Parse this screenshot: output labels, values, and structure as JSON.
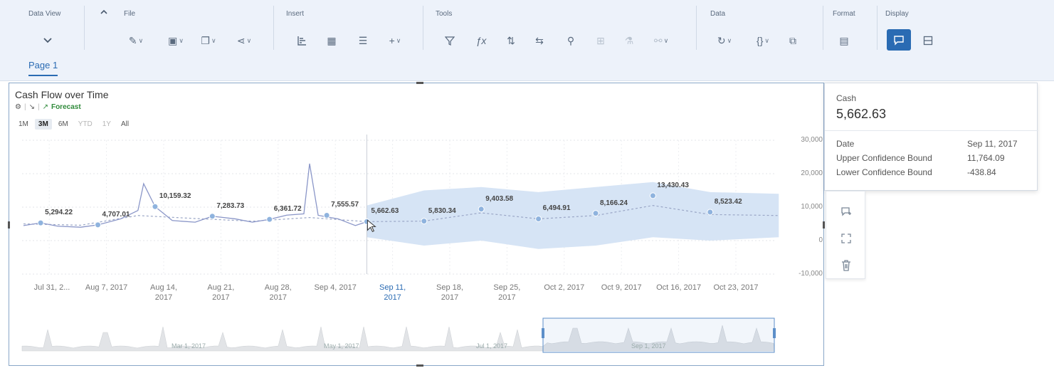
{
  "toolbar": {
    "data_view": {
      "title": "Data View",
      "chevron": "chevron-down-icon"
    },
    "file": {
      "title": "File",
      "collapse": "chevron-up-icon"
    },
    "insert": {
      "title": "Insert"
    },
    "tools": {
      "title": "Tools"
    },
    "data": {
      "title": "Data"
    },
    "format": {
      "title": "Format"
    },
    "display": {
      "title": "Display"
    },
    "accent": "#2a6bb3"
  },
  "tabs": [
    {
      "label": "Page 1"
    }
  ],
  "widget": {
    "title": "Cash Flow over Time",
    "forecast_label": "Forecast",
    "ranges": [
      "1M",
      "3M",
      "6M",
      "YTD",
      "1Y",
      "All"
    ],
    "selected_range": "3M"
  },
  "chart_data": {
    "type": "line",
    "y_ticks": [
      "30,000",
      "20,000",
      "10,000",
      "0",
      "-10,000"
    ],
    "ylim": [
      -10000,
      30000
    ],
    "x_ticks": [
      {
        "l1": "Jul 31, 2...",
        "l2": ""
      },
      {
        "l1": "Aug 7, 2017",
        "l2": ""
      },
      {
        "l1": "Aug 14,",
        "l2": "2017"
      },
      {
        "l1": "Aug 21,",
        "l2": "2017"
      },
      {
        "l1": "Aug 28,",
        "l2": "2017"
      },
      {
        "l1": "Sep 4, 2017",
        "l2": ""
      },
      {
        "l1": "Sep 11,",
        "l2": "2017"
      },
      {
        "l1": "Sep 18,",
        "l2": "2017"
      },
      {
        "l1": "Sep 25,",
        "l2": "2017"
      },
      {
        "l1": "Oct 2, 2017",
        "l2": ""
      },
      {
        "l1": "Oct 9, 2017",
        "l2": ""
      },
      {
        "l1": "Oct 16, 2017",
        "l2": ""
      },
      {
        "l1": "Oct 23, 2017",
        "l2": ""
      }
    ],
    "selected_tick": 6,
    "points": [
      {
        "x": 0.3,
        "y": 5294.22,
        "label": "5,294.22"
      },
      {
        "x": 1.3,
        "y": 4707.01,
        "label": "4,707.01"
      },
      {
        "x": 2.3,
        "y": 10159.32,
        "label": "10,159.32"
      },
      {
        "x": 3.3,
        "y": 7283.73,
        "label": "7,283.73"
      },
      {
        "x": 4.3,
        "y": 6361.72,
        "label": "6,361.72"
      },
      {
        "x": 5.3,
        "y": 7555.57,
        "label": "7,555.57"
      },
      {
        "x": 6.0,
        "y": 5662.63,
        "label": "5,662.63"
      },
      {
        "x": 7.0,
        "y": 5830.34,
        "label": "5,830.34"
      },
      {
        "x": 8.0,
        "y": 9403.58,
        "label": "9,403.58"
      },
      {
        "x": 9.0,
        "y": 6494.91,
        "label": "6,494.91"
      },
      {
        "x": 10.0,
        "y": 8166.24,
        "label": "8,166.24"
      },
      {
        "x": 11.0,
        "y": 13430.43,
        "label": "13,430.43"
      },
      {
        "x": 12.0,
        "y": 8523.42,
        "label": "8,523.42"
      }
    ],
    "actual_series": [
      [
        0,
        4500
      ],
      [
        0.3,
        5294
      ],
      [
        0.6,
        4300
      ],
      [
        1.0,
        4000
      ],
      [
        1.3,
        4707
      ],
      [
        1.7,
        6500
      ],
      [
        2.0,
        9000
      ],
      [
        2.1,
        17000
      ],
      [
        2.3,
        10159
      ],
      [
        2.6,
        6000
      ],
      [
        3.0,
        5500
      ],
      [
        3.3,
        7283
      ],
      [
        3.7,
        6500
      ],
      [
        4.0,
        5500
      ],
      [
        4.3,
        6361
      ],
      [
        4.6,
        7600
      ],
      [
        4.9,
        8000
      ],
      [
        5.0,
        23000
      ],
      [
        5.15,
        7555
      ],
      [
        5.5,
        6500
      ],
      [
        5.8,
        4500
      ],
      [
        6.0,
        5662
      ]
    ],
    "forecast_series": [
      [
        0,
        5000
      ],
      [
        1,
        4600
      ],
      [
        2,
        7500
      ],
      [
        3,
        6600
      ],
      [
        4,
        5800
      ],
      [
        5,
        6900
      ],
      [
        6,
        5662
      ],
      [
        7,
        5830
      ],
      [
        8,
        8300
      ],
      [
        9,
        6500
      ],
      [
        10,
        7500
      ],
      [
        11,
        10500
      ],
      [
        12,
        7800
      ],
      [
        13.2,
        7500
      ]
    ],
    "confidence_upper": [
      [
        6,
        10500
      ],
      [
        7,
        15000
      ],
      [
        8,
        16000
      ],
      [
        9,
        14500
      ],
      [
        10,
        16000
      ],
      [
        11,
        17500
      ],
      [
        12,
        14500
      ],
      [
        13.2,
        14000
      ]
    ],
    "confidence_lower": [
      [
        6,
        1000
      ],
      [
        7,
        -1500
      ],
      [
        8,
        0
      ],
      [
        9,
        -2500
      ],
      [
        10,
        -1500
      ],
      [
        11,
        1000
      ],
      [
        12,
        0
      ],
      [
        13.2,
        1000
      ]
    ],
    "series_color": "#8a96c8",
    "band_color": "#d6e4f5"
  },
  "navigator": {
    "labels": [
      "Mar 1, 2017",
      "May 1, 2017",
      "Jul 1, 2017",
      "Sep 1, 2017"
    ]
  },
  "tooltip": {
    "label": "Cash",
    "value": "5,662.63",
    "rows": [
      {
        "k": "Date",
        "v": "Sep 11, 2017"
      },
      {
        "k": "Upper Confidence Bound",
        "v": "11,764.09"
      },
      {
        "k": "Lower Confidence Bound",
        "v": "-438.84"
      }
    ]
  },
  "side_panel": [
    "comment-add-icon",
    "fullscreen-icon",
    "trash-icon"
  ]
}
